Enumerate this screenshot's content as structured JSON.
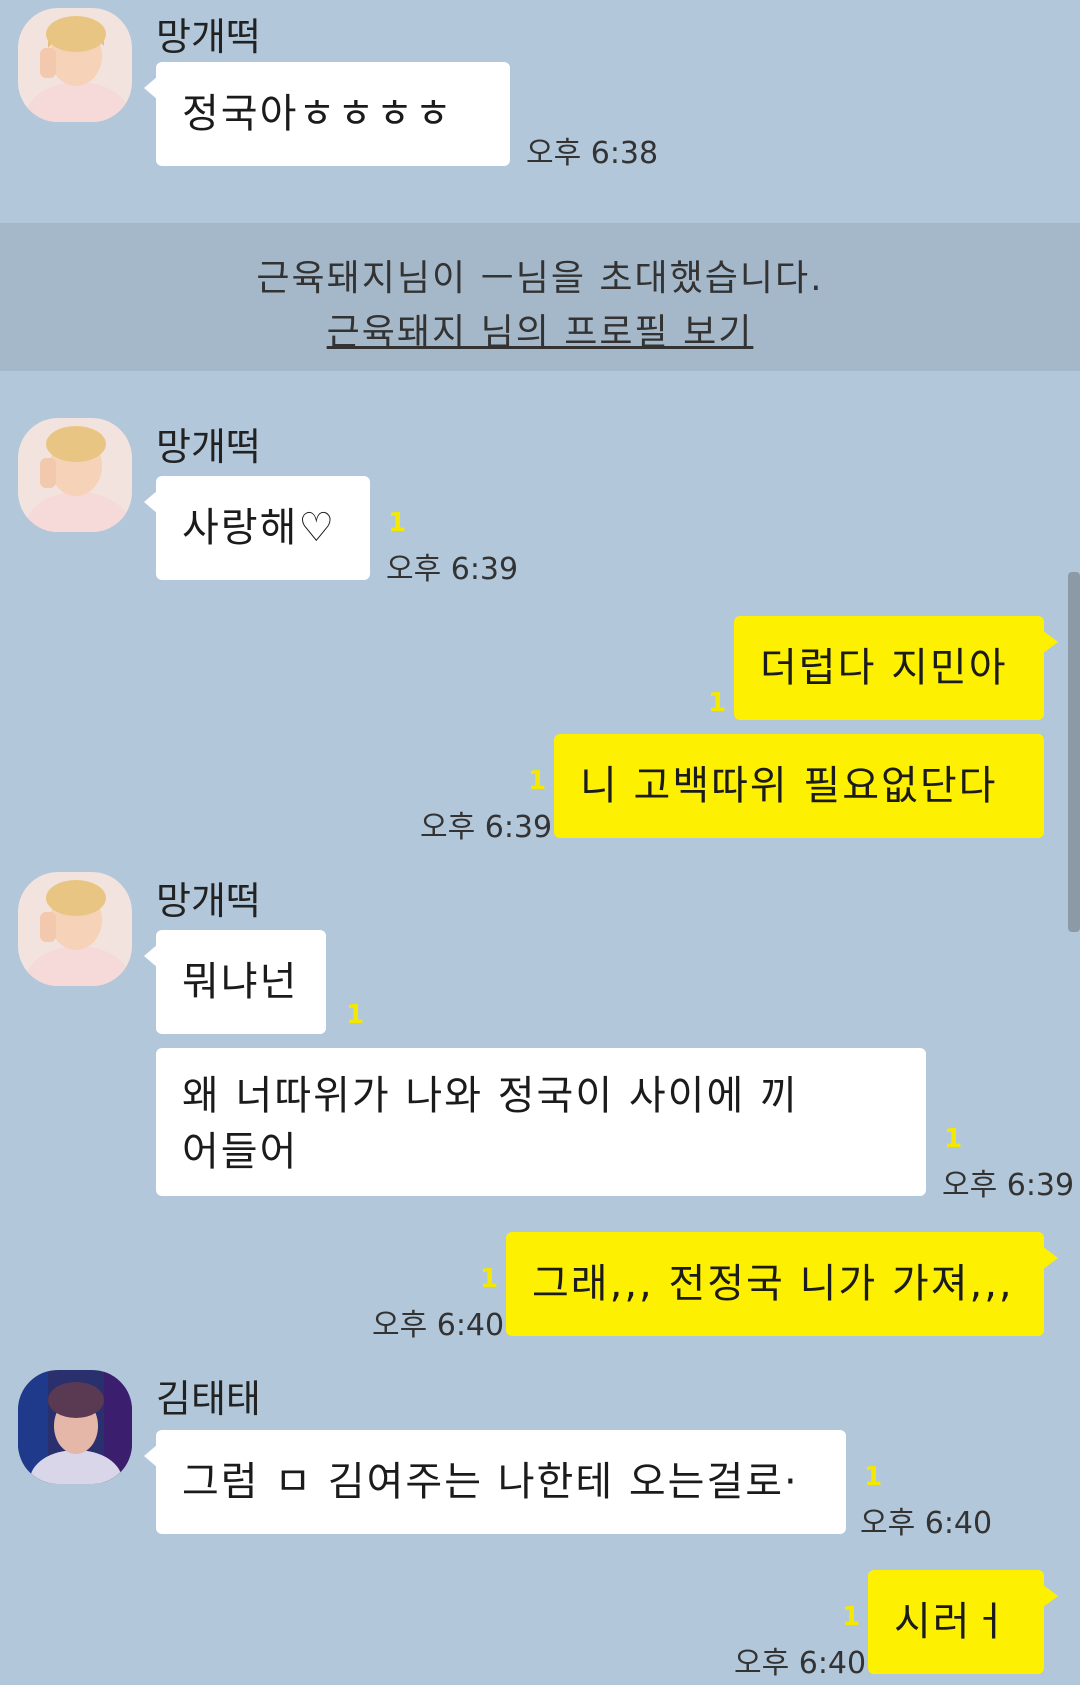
{
  "system": {
    "invite_text": "근육돼지님이 ㅡ님을 초대했습니다.",
    "profile_link": "근육돼지 님의 프로필 보기"
  },
  "messages": [
    {
      "sender": "망개떡",
      "text": "정국아ㅎㅎㅎㅎ",
      "time": "오후 6:38"
    },
    {
      "sender": "망개떡",
      "text": "사랑해♡",
      "unread": "1",
      "time": "오후 6:39"
    },
    {
      "text": "더럽다 지민아",
      "unread": "1"
    },
    {
      "text": "니 고백따위 필요없단다",
      "unread": "1",
      "time": "오후 6:39"
    },
    {
      "sender": "망개떡",
      "text": "뭐냐넌",
      "unread": "1"
    },
    {
      "text": "왜 너따위가 나와 정국이 사이에 끼어들어",
      "unread": "1",
      "time": "오후 6:39"
    },
    {
      "text": "그래,,, 전정국 니가 가져,,,",
      "unread": "1",
      "time": "오후 6:40"
    },
    {
      "sender": "김태태",
      "text": "그럼 ㅁ 김여주는 나한테 오는걸로·",
      "unread": "1",
      "time": "오후 6:40"
    },
    {
      "text": "시러ㅓ",
      "unread": "1",
      "time": "오후 6:40"
    }
  ],
  "colors": {
    "background": "#b2c7da",
    "sent_bubble": "#fdf000",
    "received_bubble": "#ffffff",
    "unread": "#f4e800"
  }
}
